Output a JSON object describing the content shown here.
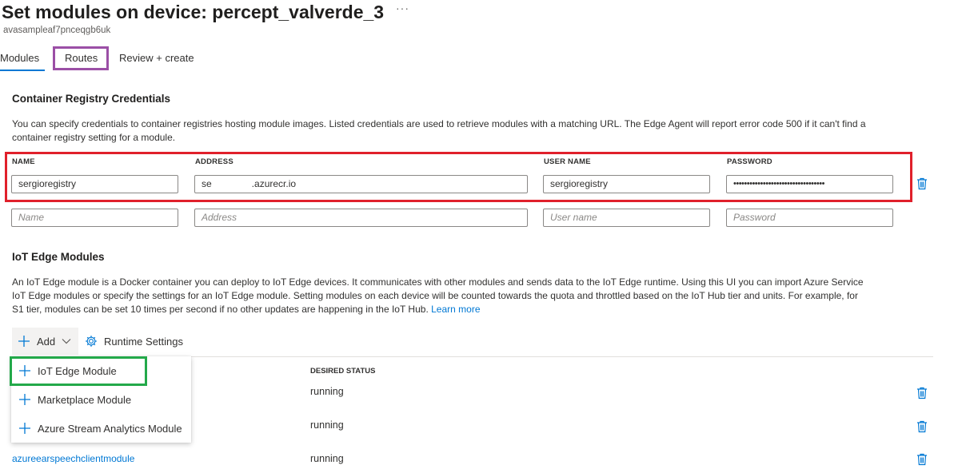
{
  "header": {
    "title": "Set modules on device: percept_valverde_3",
    "more": "···",
    "subtitle": "avasampleaf7pnceqgb6uk"
  },
  "tabs": [
    {
      "label": "Modules",
      "active": true
    },
    {
      "label": "Routes",
      "active": false
    },
    {
      "label": "Review + create",
      "active": false
    }
  ],
  "registry": {
    "title": "Container Registry Credentials",
    "description_line1": "You can specify credentials to container registries hosting module images. Listed credentials are used to retrieve modules with a matching URL. The Edge Agent will report error code 500 if it can't find a",
    "description_line2": "container registry setting for a module.",
    "columns": {
      "name": "NAME",
      "address": "ADDRESS",
      "username": "USER NAME",
      "password": "PASSWORD"
    },
    "row": {
      "name": "sergioregistry",
      "address": "se               .azurecr.io",
      "username": "sergioregistry",
      "password": "••••••••••••••••••••••••••••••••••"
    },
    "new_row_placeholders": {
      "name": "Name",
      "address": "Address",
      "username": "User name",
      "password": "Password"
    }
  },
  "modules": {
    "title": "IoT Edge Modules",
    "description_line1": "An IoT Edge module is a Docker container you can deploy to IoT Edge devices. It communicates with other modules and sends data to the IoT Edge runtime. Using this UI you can import Azure Service",
    "description_line2": "IoT Edge modules or specify the settings for an IoT Edge module. Setting modules on each device will be counted towards the quota and throttled based on the IoT Hub tier and units. For example, for",
    "description_line3": "S1 tier, modules can be set 10 times per second if no other updates are happening in the IoT Hub.",
    "learn_more": "Learn more",
    "toolbar": {
      "add": "Add",
      "runtime_settings": "Runtime Settings"
    },
    "desired_status_header": "DESIRED STATUS",
    "rows": [
      {
        "name": "",
        "status": "running"
      },
      {
        "name": "",
        "status": "running"
      },
      {
        "name": "azureearspeechclientmodule",
        "status": "running"
      }
    ],
    "add_menu": [
      {
        "label": "IoT Edge Module"
      },
      {
        "label": "Marketplace Module"
      },
      {
        "label": "Azure Stream Analytics Module"
      }
    ]
  },
  "colors": {
    "accent": "#0078d4",
    "highlight_red": "#e0202b",
    "highlight_purple": "#9b4fa6",
    "highlight_green": "#23a94a"
  }
}
